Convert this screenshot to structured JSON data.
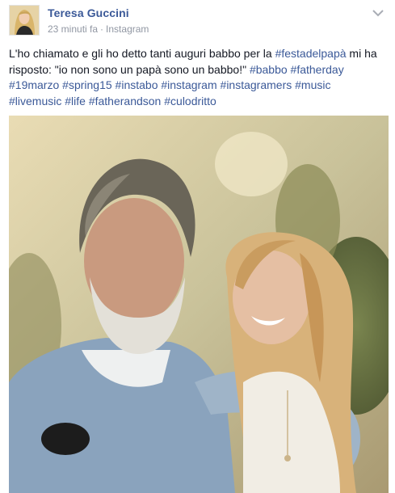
{
  "post": {
    "author": "Teresa Guccini",
    "time": "23 minuti fa",
    "separator": "·",
    "source": "Instagram",
    "text_lines": [
      [
        {
          "t": "L'ho chiamato e gli ho detto tanti auguri babbo per la ",
          "tag": false
        },
        {
          "t": "#festadelpapà",
          "tag": true
        },
        {
          "t": " mi ha",
          "tag": false
        }
      ],
      [
        {
          "t": "risposto: \"io non sono un papà sono un babbo!\" ",
          "tag": false
        },
        {
          "t": "#babbo",
          "tag": true
        },
        {
          "t": " ",
          "tag": false
        },
        {
          "t": "#fatherday",
          "tag": true
        }
      ],
      [
        {
          "t": "#19marzo",
          "tag": true
        },
        {
          "t": " ",
          "tag": false
        },
        {
          "t": "#spring15",
          "tag": true
        },
        {
          "t": " ",
          "tag": false
        },
        {
          "t": "#instabo",
          "tag": true
        },
        {
          "t": " ",
          "tag": false
        },
        {
          "t": "#instagram",
          "tag": true
        },
        {
          "t": " ",
          "tag": false
        },
        {
          "t": "#instagramers",
          "tag": true
        },
        {
          "t": " ",
          "tag": false
        },
        {
          "t": "#music",
          "tag": true
        }
      ],
      [
        {
          "t": "#livemusic",
          "tag": true
        },
        {
          "t": " ",
          "tag": false
        },
        {
          "t": "#life",
          "tag": true
        },
        {
          "t": " ",
          "tag": false
        },
        {
          "t": "#fatherandson",
          "tag": true
        },
        {
          "t": " ",
          "tag": false
        },
        {
          "t": "#culodritto",
          "tag": true
        }
      ]
    ]
  },
  "icons": {
    "menu": "chevron-down-icon",
    "avatar": "profile-photo",
    "photo": "post-photo"
  },
  "colors": {
    "link": "#3b5998",
    "meta": "#9197a3",
    "text": "#141823"
  }
}
